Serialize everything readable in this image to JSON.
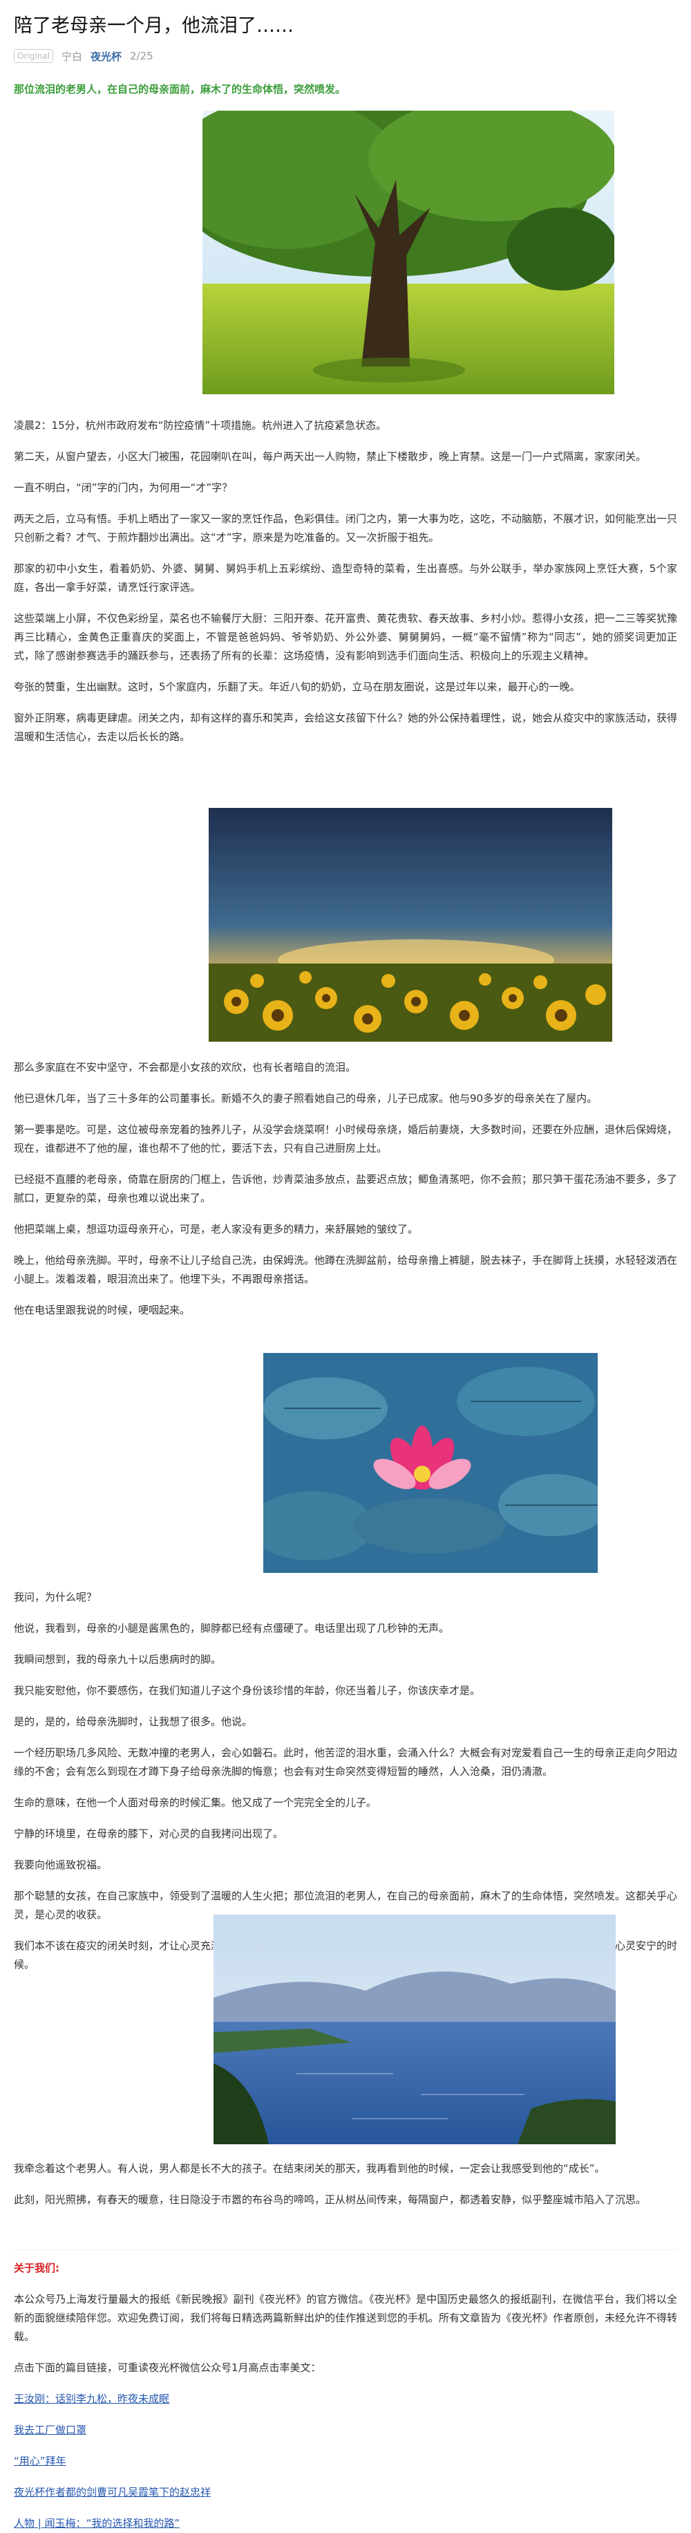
{
  "article": {
    "title": "陪了老母亲一个月，他流泪了……",
    "badge": "Original",
    "author": "宁白",
    "account": "夜光杯",
    "date": "2/25",
    "lead": "那位流泪的老男人，在自己的母亲面前，麻木了的生命体悟，突然喷发。",
    "paragraphs1": [
      "凌晨2：15分，杭州市政府发布“防控疫情”十项措施。杭州进入了抗疫紧急状态。",
      "第二天，从窗户望去，小区大门被围，花园喇叭在叫，每户两天出一人购物，禁止下楼散步，晚上宵禁。这是一门一户式隔离，家家闭关。",
      "一直不明白，“闭”字的门内，为何用一“才”字？",
      "两天之后，立马有悟。手机上晒出了一家又一家的烹饪作品，色彩俱佳。闭门之内，第一大事为吃，这吃，不动脑筋，不展才识，如何能烹出一只只创新之肴？才气、于煎炸翻炒出满出。这“才”字，原来是为吃准备的。又一次折服于祖先。",
      "那家的初中小女生，看着奶奶、外婆、舅舅、舅妈手机上五彩缤纷、造型奇特的菜肴，生出喜感。与外公联手，举办家族网上烹饪大赛，5个家庭，各出一拿手好菜，请烹饪行家评选。",
      "这些菜端上小屏，不仅色彩纷呈，菜名也不输餐厅大厨：三阳开泰、花开富贵、黄花贵软、春天故事、乡村小炒。惹得小女孩，把一二三等奖犹豫再三比精心，金黄色正重喜庆的奖面上，不管是爸爸妈妈、爷爷奶奶、外公外婆、舅舅舅妈，一概“毫不留情”称为“同志”，她的颁奖词更加正式，除了感谢参赛选手的踊跃参与，还表扬了所有的长辈：这场疫情，没有影响到选手们面向生活、积极向上的乐观主义精神。",
      "夸张的赞重，生出幽默。这时，5个家庭内，乐翻了天。年近八旬的奶奶，立马在朋友圈说，这是过年以来，最开心的一晚。",
      "窗外正阴寒，病毒更肆虐。闭关之内，却有这样的喜乐和笑声，会给这女孩留下什么？她的外公保持着理性，说，她会从疫灾中的家族活动，获得温暖和生活信心，去走以后长长的路。"
    ],
    "paragraphs2": [
      "那么多家庭在不安中坚守，不会都是小女孩的欢欣，也有长者暗自的流泪。",
      "他已退休几年，当了三十多年的公司董事长。新婚不久的妻子照看她自己的母亲，儿子已成家。他与90多岁的母亲关在了屋内。",
      "第一要事是吃。可是，这位被母亲宠着的独养儿子，从没学会烧菜啊！小时候母亲烧，婚后前妻烧，大多数时间，还要在外应酬，退休后保姆烧，现在，谁都进不了他的屋，谁也帮不了他的忙，要活下去，只有自己进厨房上灶。",
      "已经挺不直腰的老母亲，倚靠在厨房的门框上，告诉他，炒青菜油多放点，盐要迟点放；鲫鱼清蒸吧，你不会煎；那只笋干蛋花汤油不要多，多了腻口，更复杂的菜，母亲也难以说出来了。",
      "他把菜端上桌，想逗功逗母亲开心，可是，老人家没有更多的精力，来舒展她的皱纹了。",
      "晚上，他给母亲洗脚。平时，母亲不让儿子给自己洗，由保姆洗。他蹲在洗脚盆前，给母亲撸上裤腿，脱去袜子，手在脚背上抚摸，水轻轻泼洒在小腿上。泼着泼着，眼泪流出来了。他埋下头，不再跟母亲搭话。",
      "他在电话里跟我说的时候，哽咽起来。"
    ],
    "paragraphs3": [
      "我问，为什么呢？",
      "他说，我看到，母亲的小腿是酱黑色的，脚脖都已经有点僵硬了。电话里出现了几秒钟的无声。",
      "我瞬间想到，我的母亲九十以后患病时的脚。",
      "我只能安慰他，你不要感伤，在我们知道儿子这个身份该珍惜的年龄，你还当着儿子，你该庆幸才是。",
      "是的，是的，给母亲洗脚时，让我想了很多。他说。",
      "一个经历职场几多风险、无数冲撞的老男人，会心如磐石。此时，他苦涩的泪水重，会涌入什么？大概会有对宠爱看自己一生的母亲正走向夕阳边缘的不舍；会有怎么到现在才蹲下身子给母亲洗脚的悔意；也会有对生命突然变得短暂的睡然，人入沧桑，泪仍清澈。",
      "生命的意味，在他一个人面对母亲的时候汇集。他又成了一个完完全全的儿子。",
      "宁静的环境里，在母亲的膝下，对心灵的自我拷问出现了。",
      "我要向他遥致祝福。",
      "那个聪慧的女孩，在自己家族中，领受到了温暖的人生火把；那位流泪的老男人，在自己的母亲面前，麻木了的生命体悟，突然喷发。这都关乎心灵，是心灵的收获。",
      "我们本不该在疫灾的闭关时刻，才让心灵充溢，与心灵对话的。其实，在大厦霓虹下赶路，在推杯换盏间颠醉，我们仍然可以去寻找心灵安宁的时候。"
    ],
    "paragraphs4": [
      "我牵念着这个老男人。有人说，男人都是长不大的孩子。在结束闭关的那天，我再看到他的时候，一定会让我感受到他的“成长”。",
      "此刻，阳光照拂，有春天的暖意，往日隐没于市嚣的布谷鸟的啼鸣，正从树丛间传来，每隔窗户，都透着安静，似乎整座城市陷入了沉思。"
    ]
  },
  "about": {
    "heading": "关于我们:",
    "text": "本公众号乃上海发行量最大的报纸《新民晚报》副刊《夜光杯》的官方微信。《夜光杯》是中国历史最悠久的报纸副刊，在微信平台，我们将以全新的面貌继续陪伴您。欢迎免费订阅，我们将每日精选两篇新鲜出炉的佳作推送到您的手机。所有文章皆为《夜光杯》作者原创，未经允许不得转载。",
    "prompt": "点击下面的篇目链接，可重读夜光杯微信公众号1月高点击率美文：",
    "links": [
      "王汝刚：话别李九松，昨夜未成眠",
      "我去工厂做口罩",
      "“用心”拜年",
      "夜光杯作者都的剑曹可凡吴霞笔下的赵忠祥",
      "人物 | 闻玉梅：“我的选择和我的路”"
    ]
  },
  "colors": {
    "lead": "#3a9d3a",
    "accent": "#d81e1e",
    "link": "#2557b0"
  }
}
